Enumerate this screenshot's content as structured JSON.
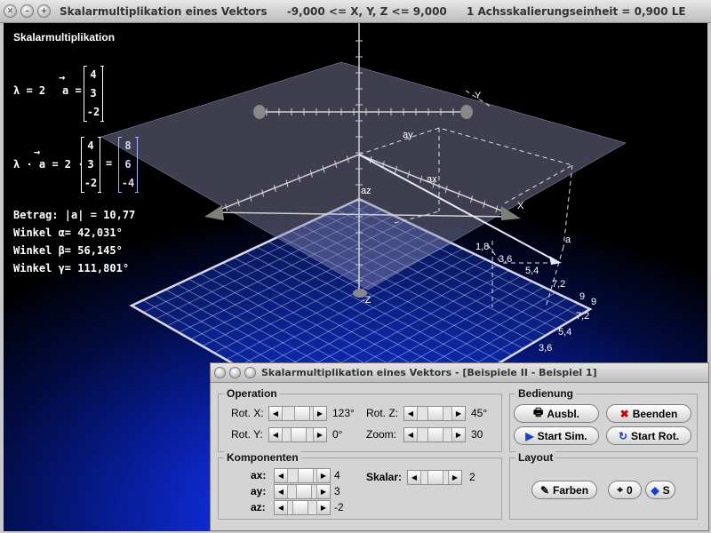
{
  "main_window": {
    "title": "Skalarmultiplikation eines Vektors",
    "range": "-9,000 <= X, Y, Z <= 9,000",
    "scale": "1 Achsskalierungseinheit = 0,900 LE"
  },
  "overlay": {
    "heading": "Skalarmultiplikation",
    "lambda_label": "λ = 2",
    "a_label": "a =",
    "vec_a": [
      "4",
      "3",
      "-2"
    ],
    "lambda_a_label": "λ · a = 2 ·",
    "equals": "=",
    "vec_result": [
      "8",
      "6",
      "-4"
    ],
    "betrag": "Betrag: |a| = 10,77",
    "winkel_alpha": "Winkel α= 42,031°",
    "winkel_beta": "Winkel β= 56,145°",
    "winkel_gamma": "Winkel γ= 111,801°"
  },
  "axes_labels": {
    "x": "X",
    "y": "Y",
    "neg_z": "-Z",
    "ax": "ax",
    "ay": "ay",
    "az": "az",
    "a": "a",
    "ticks_near": [
      "1,8",
      "3,6",
      "5,4",
      "7,2",
      "9"
    ],
    "ticks_grid": [
      "9",
      "7,2",
      "5,4",
      "3,6"
    ]
  },
  "control": {
    "title": "Skalarmultiplikation eines Vektors - [Beispiele II - Beispiel 1]",
    "operation": {
      "title": "Operation",
      "rot_x_label": "Rot. X:",
      "rot_x_value": "123°",
      "rot_y_label": "Rot. Y:",
      "rot_y_value": "0°",
      "rot_z_label": "Rot. Z:",
      "rot_z_value": "45°",
      "zoom_label": "Zoom:",
      "zoom_value": "30"
    },
    "bedienung": {
      "title": "Bedienung",
      "ausbl": "Ausbl.",
      "beenden": "Beenden",
      "start_sim": "Start Sim.",
      "start_rot": "Start Rot."
    },
    "komponenten": {
      "title": "Komponenten",
      "ax_label": "ax:",
      "ax_value": "4",
      "ay_label": "ay:",
      "ay_value": "3",
      "az_label": "az:",
      "az_value": "-2",
      "skalar_label": "Skalar:",
      "skalar_value": "2"
    },
    "layout": {
      "title": "Layout",
      "farben": "Farben",
      "zero": "0",
      "s": "S"
    }
  }
}
